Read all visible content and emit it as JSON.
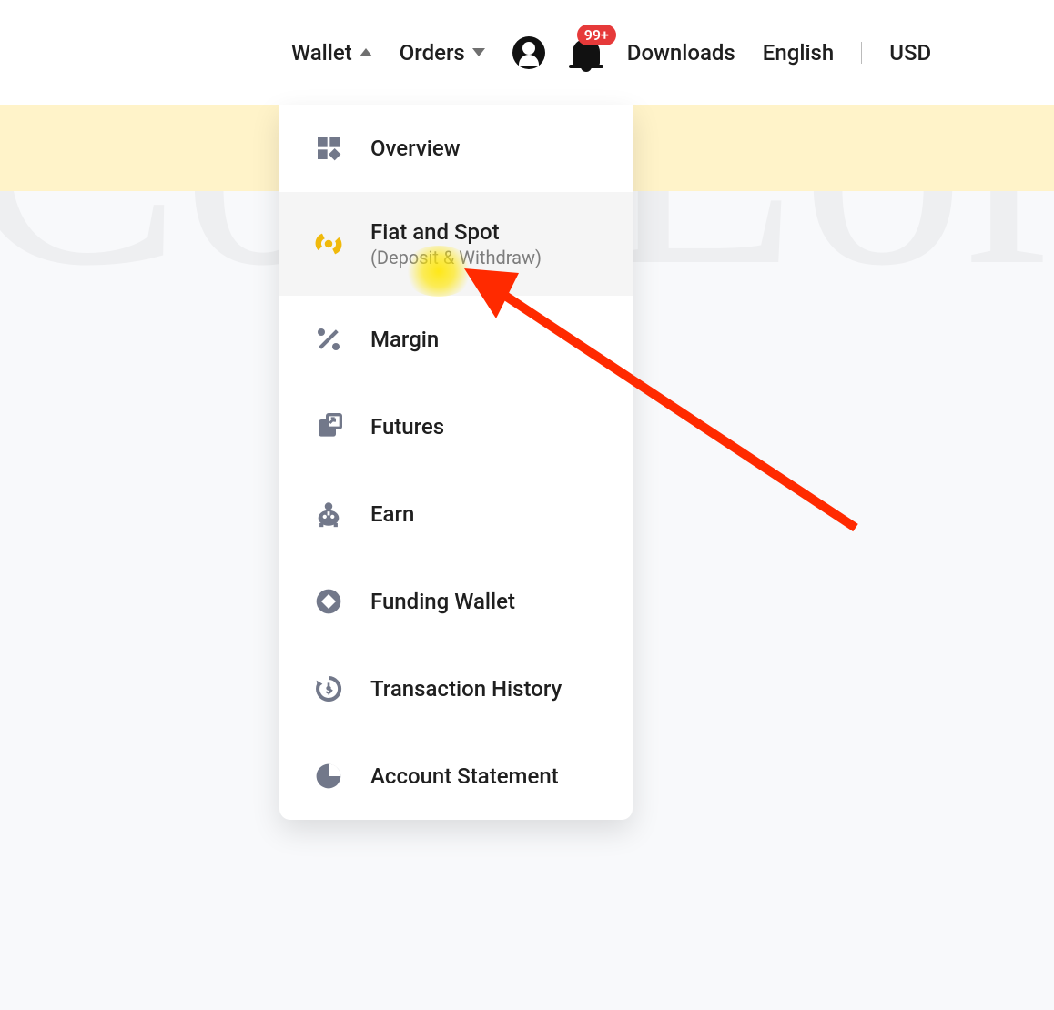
{
  "nav": {
    "wallet": "Wallet",
    "orders": "Orders",
    "downloads": "Downloads",
    "language": "English",
    "currency": "USD",
    "notification_badge": "99+"
  },
  "dropdown": {
    "items": [
      {
        "label": "Overview",
        "sub": "",
        "icon": "overview-icon"
      },
      {
        "label": "Fiat and Spot",
        "sub": "(Deposit & Withdraw)",
        "icon": "fiat-spot-icon"
      },
      {
        "label": "Margin",
        "sub": "",
        "icon": "margin-icon"
      },
      {
        "label": "Futures",
        "sub": "",
        "icon": "futures-icon"
      },
      {
        "label": "Earn",
        "sub": "",
        "icon": "earn-icon"
      },
      {
        "label": "Funding Wallet",
        "sub": "",
        "icon": "funding-wallet-icon"
      },
      {
        "label": "Transaction History",
        "sub": "",
        "icon": "transaction-history-icon"
      },
      {
        "label": "Account Statement",
        "sub": "",
        "icon": "account-statement-icon"
      }
    ]
  }
}
